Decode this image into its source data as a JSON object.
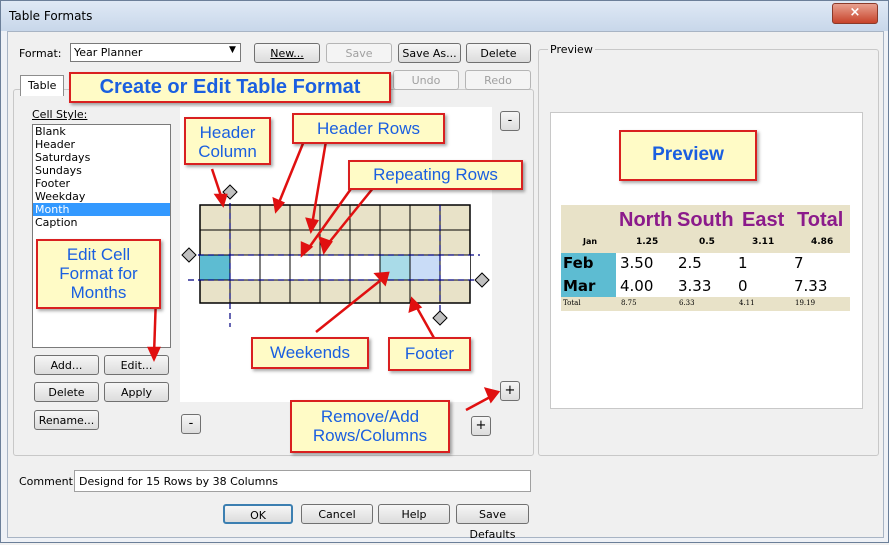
{
  "window": {
    "title": "Table Formats",
    "close_label": "×"
  },
  "format": {
    "label": "Format:",
    "selected": "Year Planner",
    "buttons": {
      "new": "New...",
      "save": "Save",
      "save_as": "Save As...",
      "delete": "Delete",
      "undo": "Undo",
      "redo": "Redo"
    }
  },
  "tab": {
    "table": "Table"
  },
  "cell_style": {
    "label": "Cell Style:",
    "items": [
      "Blank",
      "Header",
      "Saturdays",
      "Sundays",
      "Footer",
      "Weekday",
      "Month",
      "Caption"
    ],
    "selected": "Month",
    "buttons": {
      "add": "Add...",
      "edit": "Edit...",
      "delete": "Delete",
      "apply": "Apply",
      "rename": "Rename..."
    }
  },
  "grid_controls": {
    "minus": "-",
    "plus": "+"
  },
  "preview": {
    "group_label": "Preview",
    "header": [
      "North",
      "South",
      "East",
      "Total"
    ],
    "sub_row": {
      "label": "Jan",
      "values": [
        "1.25",
        "0.5",
        "3.11",
        "4.86"
      ]
    },
    "rows": [
      {
        "label": "Feb",
        "values": [
          "3.50",
          "2.5",
          "1",
          "7"
        ]
      },
      {
        "label": "Mar",
        "values": [
          "4.00",
          "3.33",
          "0",
          "7.33"
        ]
      }
    ],
    "footer": {
      "label": "Total",
      "values": [
        "8.75",
        "6.33",
        "4.11",
        "19.19"
      ]
    },
    "colors": {
      "header_bg": "#e8e2c8",
      "header_text": "#8b1a8b",
      "month_bg": "#5dbcd2"
    }
  },
  "callouts": {
    "create_edit": "Create or Edit Table Format",
    "header_column": "Header Column",
    "header_rows": "Header Rows",
    "repeating_rows": "Repeating Rows",
    "edit_cell_format": "Edit Cell Format for Months",
    "weekends": "Weekends",
    "footer": "Footer",
    "remove_add": "Remove/Add Rows/Columns",
    "preview": "Preview"
  },
  "comment": {
    "label": "Comment:",
    "value": "Designd for 15 Rows by 38 Columns"
  },
  "bottom_buttons": {
    "ok": "OK",
    "cancel": "Cancel",
    "help": "Help",
    "save_defaults": "Save Defaults"
  }
}
